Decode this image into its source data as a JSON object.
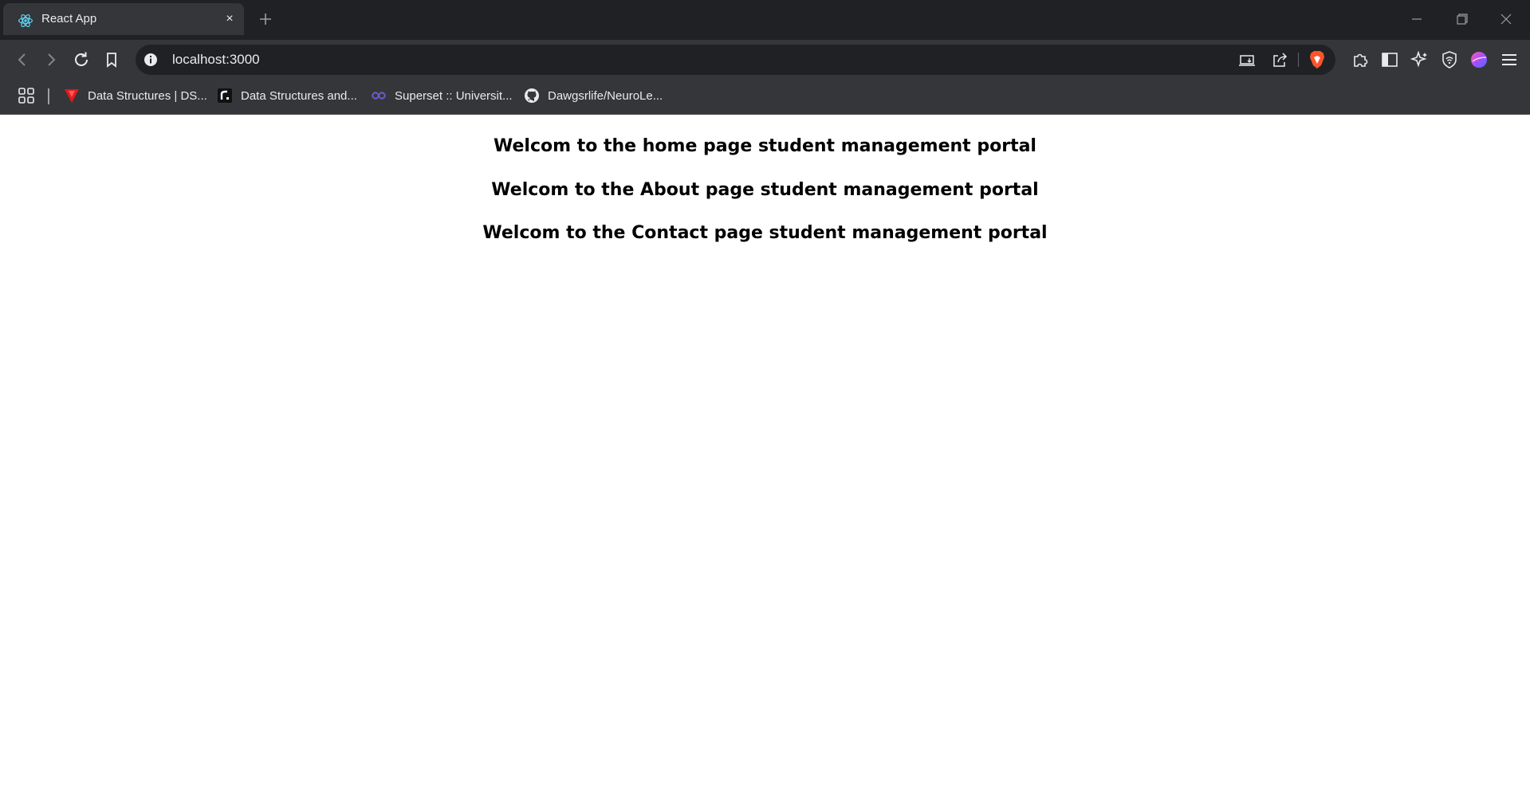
{
  "browser": {
    "tab": {
      "title": "React App",
      "favicon": "react-logo-icon",
      "close_glyph": "×"
    },
    "new_tab_icon": "plus-icon",
    "window_controls": [
      "minimize-icon",
      "restore-icon",
      "close-icon"
    ],
    "toolbar": {
      "icons": [
        "back-arrow-icon",
        "forward-arrow-icon",
        "reload-icon",
        "bookmark-icon"
      ],
      "url": "localhost:3000",
      "site_info_icon": "info-icon",
      "right_icons": [
        "install-app-icon",
        "share-icon",
        "brave-shields-icon",
        "extensions-icon",
        "sidebar-icon",
        "leo-ai-icon",
        "vpn-icon",
        "profile-avatar-icon",
        "menu-icon"
      ]
    },
    "bookmarks": [
      {
        "label": "Data Structures | DS...",
        "icon": "red-triangle-icon"
      },
      {
        "label": "Data Structures and...",
        "icon": "r-logo-icon"
      },
      {
        "label": "Superset :: Universit...",
        "icon": "superset-icon"
      },
      {
        "label": "Dawgsrlife/NeuroLe...",
        "icon": "github-icon"
      }
    ],
    "apps_icon": "apps-grid-icon"
  },
  "colors": {
    "titlebar": "#202124",
    "toolbar": "#35363a",
    "omnibox": "#202124",
    "text_light": "#e8eaed",
    "page_bg": "#ffffff",
    "heading": "#000000"
  },
  "page": {
    "headings": [
      "Welcom to the home page student management portal",
      "Welcom to the About page student management portal",
      "Welcom to the Contact page student management portal"
    ]
  }
}
